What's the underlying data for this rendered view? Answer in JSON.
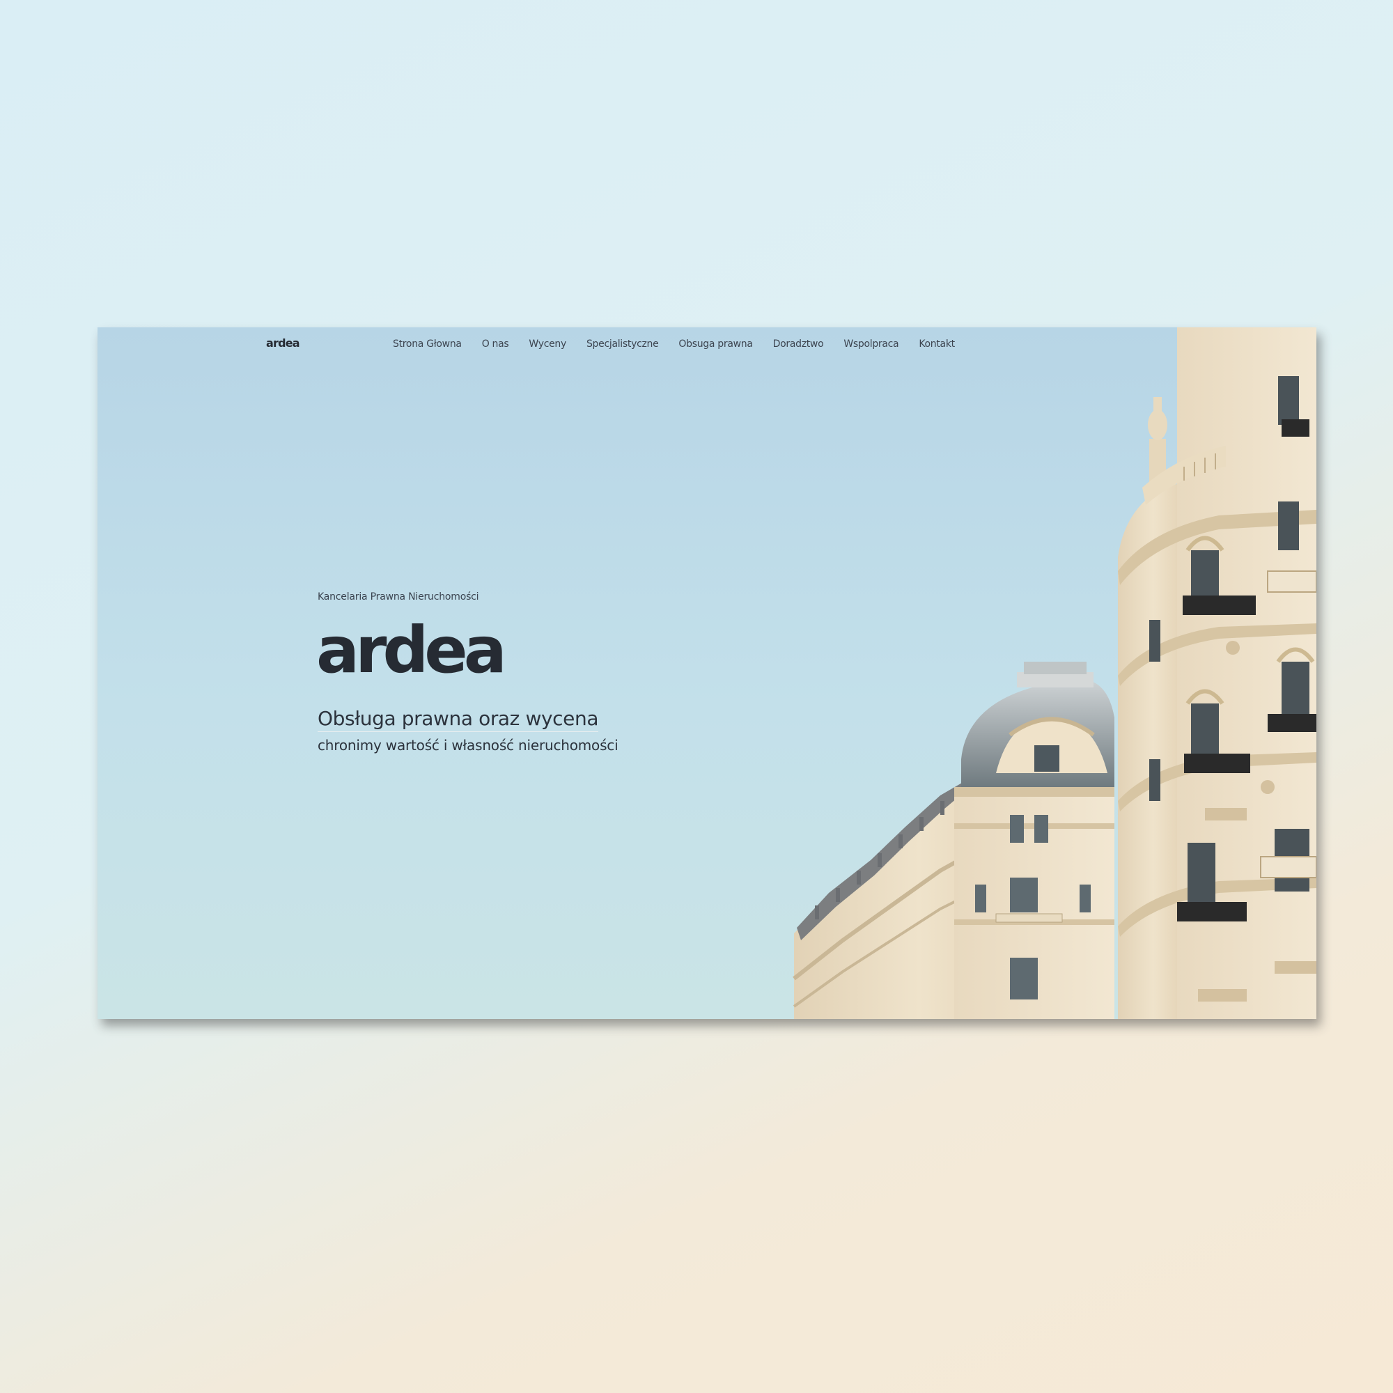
{
  "header": {
    "logo": "ardea",
    "nav": [
      {
        "label": "Strona Głowna"
      },
      {
        "label": "O nas"
      },
      {
        "label": "Wyceny"
      },
      {
        "label": "Specjalistyczne"
      },
      {
        "label": "Obsuga prawna"
      },
      {
        "label": "Doradztwo"
      },
      {
        "label": "Wspolpraca"
      },
      {
        "label": "Kontakt"
      }
    ]
  },
  "hero": {
    "eyebrow": "Kancelaria Prawna Nieruchomości",
    "logo": "ardea",
    "title": "Obsługa prawna oraz wycena",
    "subtitle": "chronimy wartość i własność nieruchomości"
  },
  "colors": {
    "sky": "#bfdde8",
    "text_dark": "#262b33",
    "building": "#eee1c8"
  },
  "icons": {
    "hero_image": "building-photo"
  }
}
